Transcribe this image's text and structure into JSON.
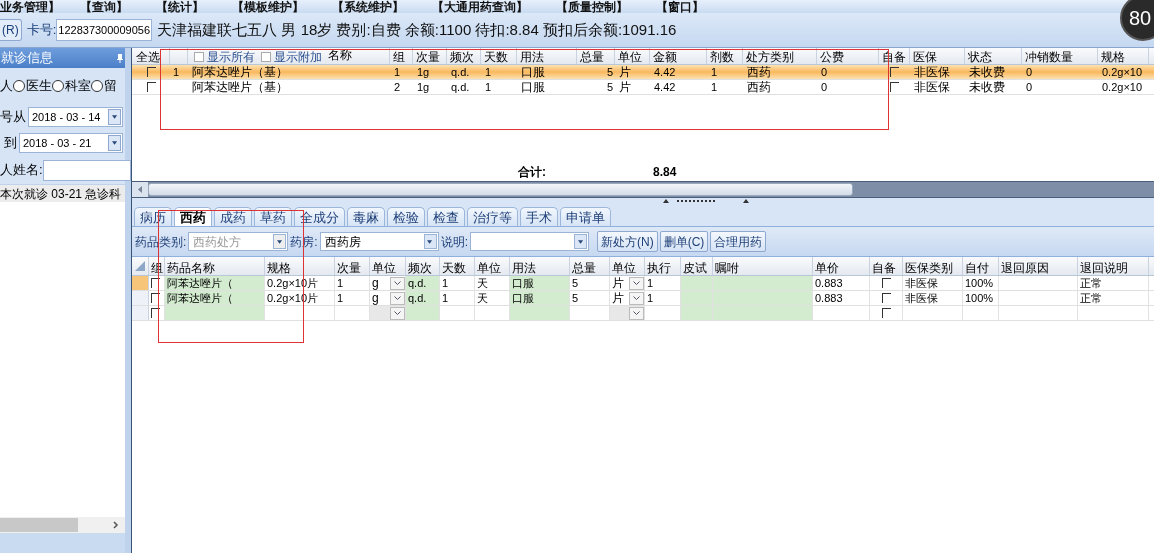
{
  "menu": [
    "业务管理】",
    "【查询】",
    "【统计】",
    "【模板维护】",
    "【系统维护】",
    "【大通用药查询】",
    "【质量控制】",
    "【窗口】"
  ],
  "gauge": {
    "value": "80"
  },
  "patient_bar": {
    "card_button": "(R)",
    "card_label": "卡号:",
    "card_value": "122837300009056",
    "summary": "天津福建联七五八  男  18岁  费别:自费  余额:1100  待扣:8.84  预扣后余额:1091.16"
  },
  "left_panel": {
    "title": "就诊信息",
    "filters": [
      {
        "label": "人",
        "selected": false
      },
      {
        "label": "医生",
        "selected": false
      },
      {
        "label": "科室",
        "selected": false
      },
      {
        "label": "留"
      }
    ],
    "date_from": {
      "label": "号从",
      "value": "2018 - 03 - 14"
    },
    "date_to": {
      "label": "到",
      "value": "2018 - 03 - 21"
    },
    "name_label": "人姓名:",
    "visits": [
      "本次就诊  03-21  急诊科"
    ]
  },
  "order_grid": {
    "select_all": "全选",
    "show_all": {
      "label": "显示所有",
      "checked": false
    },
    "show_extra": {
      "label": "显示附加",
      "checked": false
    },
    "columns": [
      "名称",
      "组",
      "次量",
      "频次",
      "天数",
      "用法",
      "总量",
      "单位",
      "金额",
      "剂数",
      "处方类别",
      "公费",
      "自备",
      "医保",
      "状态",
      "冲销数量",
      "规格"
    ],
    "rows": [
      {
        "selected": true,
        "checked": false,
        "number": "1",
        "cells": [
          "阿苯达唑片（基）",
          "1",
          "1g",
          "q.d.",
          "1",
          "口服",
          "5",
          "片",
          "4.42",
          "1",
          "西药",
          "0"
        ],
        "self_supplied": false,
        "tail": [
          "非医保",
          "未收费",
          "0",
          "0.2g×10"
        ]
      },
      {
        "selected": false,
        "checked": false,
        "cells": [
          "阿苯达唑片（基）",
          "2",
          "1g",
          "q.d.",
          "1",
          "口服",
          "5",
          "片",
          "4.42",
          "1",
          "西药",
          "0"
        ],
        "self_supplied": false,
        "tail": [
          "非医保",
          "未收费",
          "0",
          "0.2g×10"
        ]
      }
    ],
    "total_label": "合计:",
    "total_value": "8.84"
  },
  "tabs": [
    {
      "label": "病历",
      "selected": false
    },
    {
      "label": "西药",
      "selected": true
    },
    {
      "label": "成药",
      "selected": false
    },
    {
      "label": "草药",
      "selected": false
    },
    {
      "label": "全成分",
      "selected": false
    },
    {
      "label": "毒麻",
      "selected": false
    },
    {
      "label": "检验",
      "selected": false
    },
    {
      "label": "检查",
      "selected": false
    },
    {
      "label": "治疗等",
      "selected": false
    },
    {
      "label": "手术",
      "selected": false
    },
    {
      "label": "申请单",
      "selected": false
    }
  ],
  "toolbar": {
    "category": {
      "label": "药品类别:",
      "value": "西药处方",
      "disabled": true
    },
    "pharmacy": {
      "label": "药房:",
      "value": "西药房",
      "disabled": false
    },
    "note": {
      "label": "说明:",
      "disabled": false
    },
    "buttons": [
      "新处方(N)",
      "删单(C)",
      "合理用药"
    ]
  },
  "drug_grid": {
    "columns": [
      "组",
      "药品名称",
      "规格",
      "次量",
      "单位",
      "频次",
      "天数",
      "单位",
      "用法",
      "总量",
      "单位",
      "执行",
      "皮试",
      "嘱咐",
      "单价",
      "自备",
      "医保类别",
      "自付",
      "退回原因",
      "退回说明"
    ],
    "rows": [
      {
        "selected": true,
        "group_checked": false,
        "name": "阿苯达唑片（",
        "spec": "0.2g×10片",
        "dose": "1",
        "dose_unit": "g",
        "freq": "q.d.",
        "days": "1",
        "days_unit": "天",
        "usage": "口服",
        "total": "5",
        "total_unit": "片",
        "exec": "1",
        "price": "0.883",
        "self_supplied": false,
        "insurance_type": "非医保",
        "self_pay": "100%",
        "return_note": "正常"
      },
      {
        "selected": false,
        "group_checked": false,
        "name": "阿苯达唑片（",
        "spec": "0.2g×10片",
        "dose": "1",
        "dose_unit": "g",
        "freq": "q.d.",
        "days": "1",
        "days_unit": "天",
        "usage": "口服",
        "total": "5",
        "total_unit": "片",
        "exec": "1",
        "price": "0.883",
        "self_supplied": false,
        "insurance_type": "非医保",
        "self_pay": "100%",
        "return_note": "正常"
      },
      {
        "selected": false,
        "group_checked": false,
        "self_supplied": false
      }
    ]
  }
}
